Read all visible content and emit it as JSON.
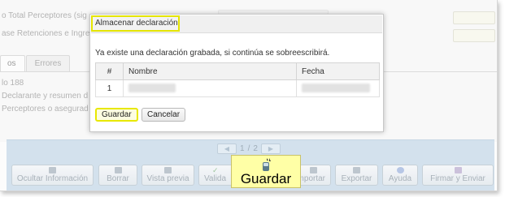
{
  "background": {
    "fields": [
      {
        "text": "o Total Perceptores (sig"
      },
      {
        "text": "ase Retenciones e Ingre"
      }
    ],
    "tabs": [
      {
        "label": "os"
      },
      {
        "label": "Errores"
      }
    ],
    "content_lines": [
      {
        "text": "lo 188"
      },
      {
        "text": "Declarante y resumen d"
      },
      {
        "text": "Perceptores o asegurad"
      }
    ],
    "pager": {
      "current": "1",
      "separator": "/",
      "total": "2"
    },
    "toolbar": [
      {
        "label": "Ocultar Información",
        "icon": "hide-icon"
      },
      {
        "label": "Borrar",
        "icon": "trash-icon"
      },
      {
        "label": "Vista previa",
        "icon": "preview-icon"
      },
      {
        "label": "Valida",
        "icon": "check-icon"
      },
      {
        "label": "mportar",
        "icon": "import-icon"
      },
      {
        "label": "Exportar",
        "icon": "export-icon"
      },
      {
        "label": "Ayuda",
        "icon": "help-icon"
      },
      {
        "label": "Firmar y Enviar",
        "icon": "sign-icon"
      }
    ]
  },
  "dialog": {
    "title": "Almacenar declaración",
    "message": "Ya existe una declaración grabada, si continúa se sobreescribirá.",
    "table": {
      "headers": {
        "hash": "#",
        "name": "Nombre",
        "date": "Fecha"
      },
      "rows": [
        {
          "num": "1"
        }
      ]
    },
    "buttons": {
      "save": "Guardar",
      "cancel": "Cancelar"
    }
  },
  "callout": {
    "label": "Guardar",
    "icon": "save-disk-icon"
  },
  "colors": {
    "highlight": "#e4e400",
    "callout_bg": "#ffffa6",
    "toolbar_band": "#bcd2e4"
  }
}
